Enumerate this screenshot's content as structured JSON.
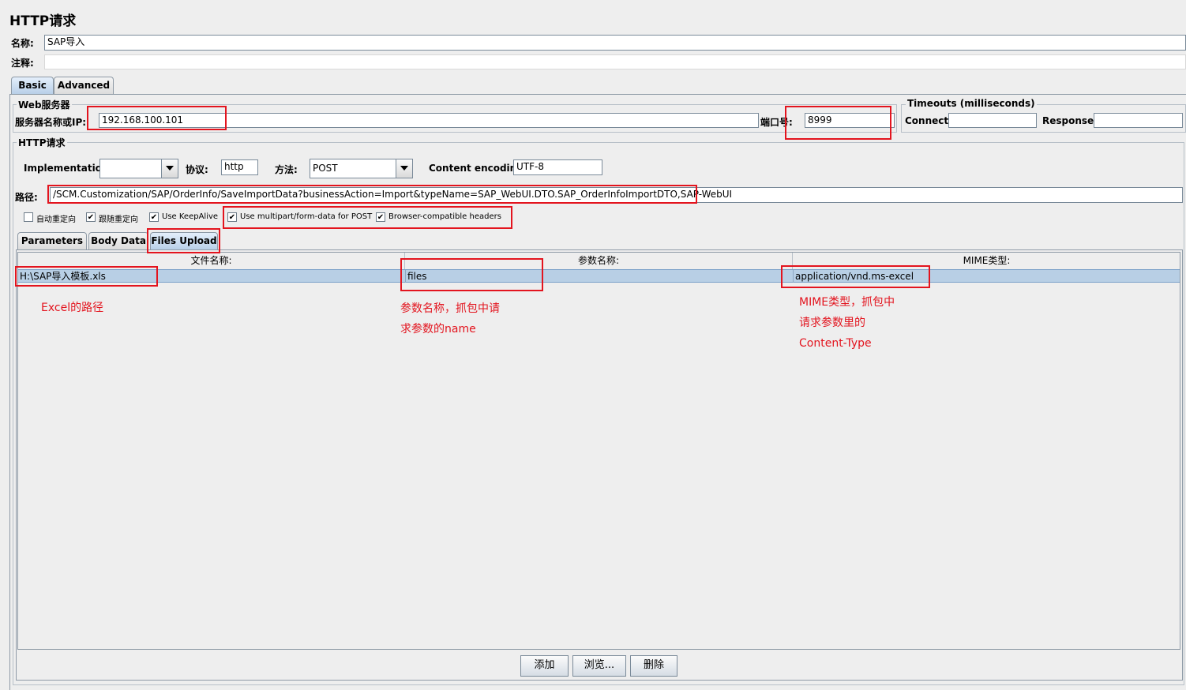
{
  "window_title": "HTTP请求",
  "name_label": "名称:",
  "name_value": "SAP导入",
  "comment_label": "注释:",
  "comment_value": "",
  "main_tabs": [
    {
      "label": "Basic",
      "selected": true
    },
    {
      "label": "Advanced",
      "selected": false
    }
  ],
  "web_server": {
    "title": "Web服务器",
    "server_label": "服务器名称或IP:",
    "server_value": "192.168.100.101",
    "port_label": "端口号:",
    "port_value": "8999"
  },
  "timeouts": {
    "title": "Timeouts (milliseconds)",
    "connect_label": "Connect:",
    "connect_value": "",
    "response_label": "Response:",
    "response_value": ""
  },
  "http_request": {
    "title": "HTTP请求",
    "implementation_label": "Implementation:",
    "implementation_value": "",
    "protocol_label": "协议:",
    "protocol_value": "http",
    "method_label": "方法:",
    "method_value": "POST",
    "encoding_label": "Content encoding:",
    "encoding_value": "UTF-8",
    "path_label": "路径:",
    "path_value": "/SCM.Customization/SAP/OrderInfo/SaveImportData?businessAction=Import&typeName=SAP_WebUI.DTO.SAP_OrderInfoImportDTO,SAP-WebUI"
  },
  "checkboxes": [
    {
      "label": "自动重定向",
      "checked": false
    },
    {
      "label": "跟随重定向",
      "checked": true
    },
    {
      "label": "Use KeepAlive",
      "checked": true
    },
    {
      "label": "Use multipart/form-data for POST",
      "checked": true
    },
    {
      "label": "Browser-compatible headers",
      "checked": true
    }
  ],
  "check_mark": "✔",
  "sub_tabs": [
    {
      "label": "Parameters",
      "selected": false
    },
    {
      "label": "Body Data",
      "selected": false
    },
    {
      "label": "Files Upload",
      "selected": true
    }
  ],
  "files_table": {
    "columns": [
      "文件名称:",
      "参数名称:",
      "MIME类型:"
    ],
    "rows": [
      {
        "file": "H:\\SAP导入模板.xls",
        "param": "files",
        "mime": "application/vnd.ms-excel"
      }
    ]
  },
  "annotations": {
    "excel_path": "Excel的路径",
    "param_line1": "参数名称，抓包中请",
    "param_line2": "求参数的name",
    "mime_line1": "MIME类型，抓包中",
    "mime_line2": "请求参数里的",
    "mime_line3": "Content-Type"
  },
  "buttons": {
    "add": "添加",
    "browse": "浏览...",
    "delete": "删除"
  },
  "colors": {
    "annotation_red": "#e3141e",
    "selected_row": "#b8cfe5",
    "background": "#eeeeee"
  }
}
